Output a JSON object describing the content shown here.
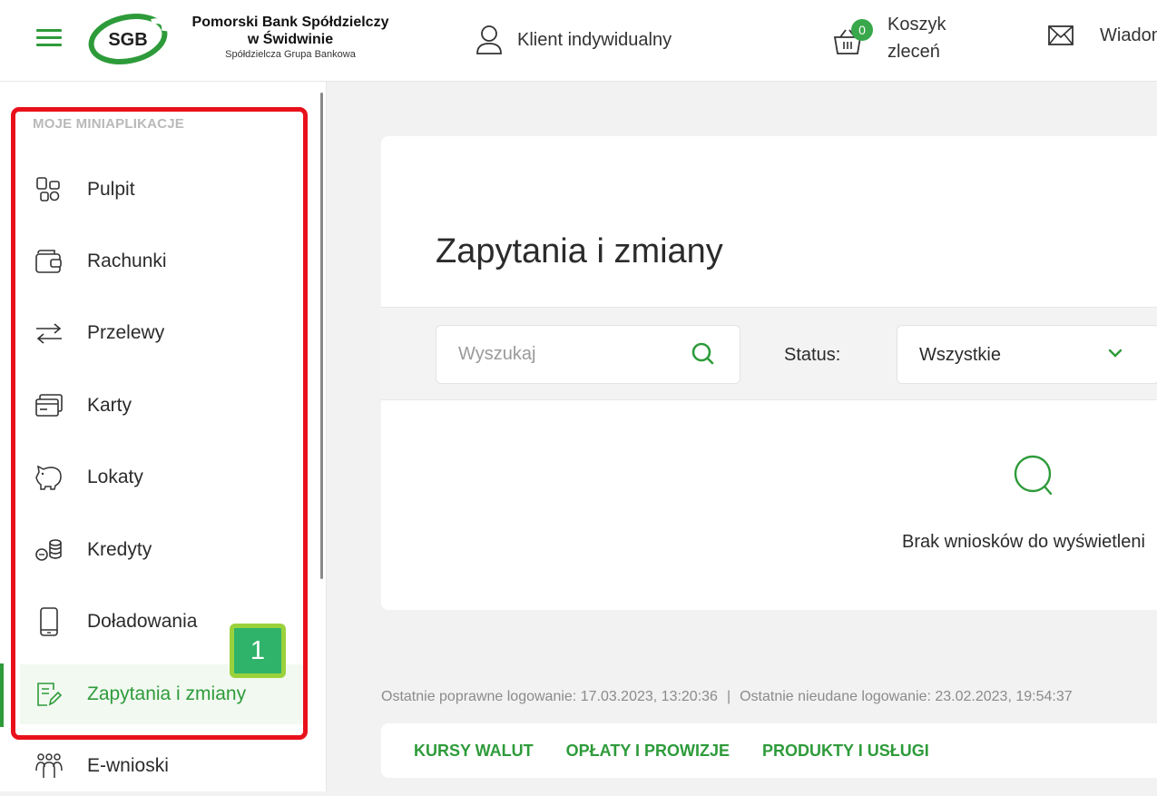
{
  "header": {
    "logo_text": "SGB",
    "bank_name_line1": "Pomorski Bank Spółdzielczy",
    "bank_name_line2": "w Świdwinie",
    "bank_name_line3": "Spółdzielcza Grupa Bankowa",
    "client_label": "Klient indywidualny",
    "cart_badge": "0",
    "cart_label_line1": "Koszyk",
    "cart_label_line2": "zleceń",
    "messages_label": "Wiadom"
  },
  "sidebar": {
    "section_title": "MOJE MINIAPLIKACJE",
    "items": [
      {
        "label": "Pulpit",
        "icon": "dashboard-icon"
      },
      {
        "label": "Rachunki",
        "icon": "wallet-icon"
      },
      {
        "label": "Przelewy",
        "icon": "transfer-arrows-icon"
      },
      {
        "label": "Karty",
        "icon": "cards-icon"
      },
      {
        "label": "Lokaty",
        "icon": "piggy-bank-icon"
      },
      {
        "label": "Kredyty",
        "icon": "coins-icon"
      },
      {
        "label": "Doładowania",
        "icon": "phone-icon"
      },
      {
        "label": "Zapytania i zmiany",
        "icon": "edit-document-icon",
        "active": true
      },
      {
        "label": "E-wnioski",
        "icon": "people-icon"
      }
    ],
    "step_badge": "1"
  },
  "main": {
    "title": "Zapytania i zmiany",
    "search_placeholder": "Wyszukaj",
    "status_label": "Status:",
    "status_value": "Wszystkie",
    "empty_message": "Brak wniosków do wyświetleni"
  },
  "footer": {
    "last_login": "Ostatnie poprawne logowanie: 17.03.2023, 13:20:36",
    "separator": "|",
    "last_failed_login": "Ostatnie nieudane logowanie: 23.02.2023, 19:54:37",
    "links": [
      "KURSY WALUT",
      "OPŁATY I PROWIZJE",
      "PRODUKTY I USŁUGI"
    ]
  },
  "colors": {
    "brand_green": "#2e9b3a",
    "highlight_red": "#e8111b",
    "badge_green": "#2fb36a"
  }
}
